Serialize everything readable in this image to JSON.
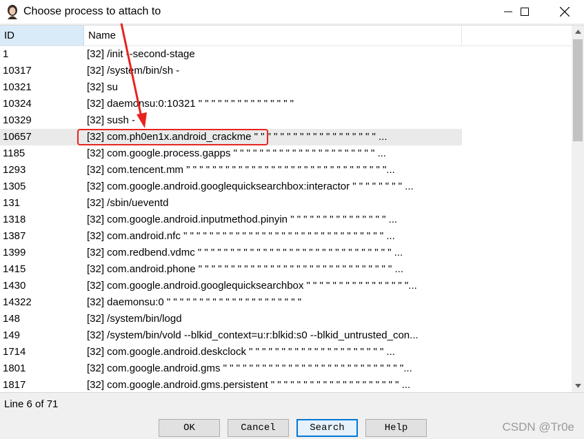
{
  "window": {
    "title": "Choose process to attach to",
    "icon": "avatar-icon",
    "controls": [
      "minimize-icon",
      "maximize-icon",
      "close-icon"
    ]
  },
  "table": {
    "columns": [
      "ID",
      "Name"
    ],
    "rows": [
      {
        "id": "1",
        "name": "[32] /init --second-stage"
      },
      {
        "id": "10317",
        "name": "[32] /system/bin/sh -"
      },
      {
        "id": "10321",
        "name": "[32] su"
      },
      {
        "id": "10324",
        "name": "[32] daemonsu:0:10321 \" \" \" \" \" \" \" \" \" \" \" \" \" \" \""
      },
      {
        "id": "10329",
        "name": "[32] sush -"
      },
      {
        "id": "10657",
        "name": "[32] com.ph0en1x.android_crackme \" \" \" \" \" \" \" \" \" \" \" \" \" \" \" \" \" \" \" ..."
      },
      {
        "id": "1185",
        "name": "[32] com.google.process.gapps \" \" \" \" \" \" \" \" \" \" \" \" \" \" \" \" \" \" \" \" \" \" ..."
      },
      {
        "id": "1293",
        "name": "[32] com.tencent.mm \" \" \" \" \" \" \" \" \" \" \" \" \" \" \" \" \" \" \" \" \" \" \" \" \" \" \" \" \" \" \"..."
      },
      {
        "id": "1305",
        "name": "[32] com.google.android.googlequicksearchbox:interactor \" \" \" \" \" \" \" \" ..."
      },
      {
        "id": "131",
        "name": "[32] /sbin/ueventd"
      },
      {
        "id": "1318",
        "name": "[32] com.google.android.inputmethod.pinyin \" \" \" \" \" \" \" \" \" \" \" \" \" \" \" ..."
      },
      {
        "id": "1387",
        "name": "[32] com.android.nfc \" \" \" \" \" \" \" \" \" \" \" \" \" \" \" \" \" \" \" \" \" \" \" \" \" \" \" \" \" \" \" ..."
      },
      {
        "id": "1399",
        "name": "[32] com.redbend.vdmc \" \" \" \" \" \" \" \" \" \" \" \" \" \" \" \" \" \" \" \" \" \" \" \" \" \" \" \" \" \" ..."
      },
      {
        "id": "1415",
        "name": "[32] com.android.phone \" \" \" \" \" \" \" \" \" \" \" \" \" \" \" \" \" \" \" \" \" \" \" \" \" \" \" \" \" \" ..."
      },
      {
        "id": "1430",
        "name": "[32] com.google.android.googlequicksearchbox \" \" \" \" \" \" \" \" \" \" \" \" \" \" \" \"..."
      },
      {
        "id": "14322",
        "name": "[32] daemonsu:0     \" \" \" \" \" \" \" \" \" \" \" \" \" \" \" \" \" \" \" \" \""
      },
      {
        "id": "148",
        "name": "[32] /system/bin/logd"
      },
      {
        "id": "149",
        "name": "[32] /system/bin/vold --blkid_context=u:r:blkid:s0 --blkid_untrusted_con..."
      },
      {
        "id": "1714",
        "name": "[32] com.google.android.deskclock \" \" \" \" \" \" \" \" \" \" \" \" \" \" \" \" \" \" \" \" \" ..."
      },
      {
        "id": "1801",
        "name": "[32] com.google.android.gms \" \" \" \" \" \" \" \" \" \" \" \" \" \" \" \" \" \" \" \" \" \" \" \" \" \" \" \"..."
      },
      {
        "id": "1817",
        "name": "[32] com.google.android.gms.persistent \" \" \" \" \" \" \" \" \" \" \" \" \" \" \" \" \" \" \" \" ..."
      }
    ],
    "selected_index": 5
  },
  "status": "Line 6 of 71",
  "buttons": {
    "ok": "OK",
    "cancel": "Cancel",
    "search": "Search",
    "help": "Help"
  },
  "watermark": "CSDN @Tr0e",
  "colors": {
    "highlight": "#e8231f",
    "header_selected": "#d9ebf9",
    "default_button_border": "#0078d7"
  }
}
